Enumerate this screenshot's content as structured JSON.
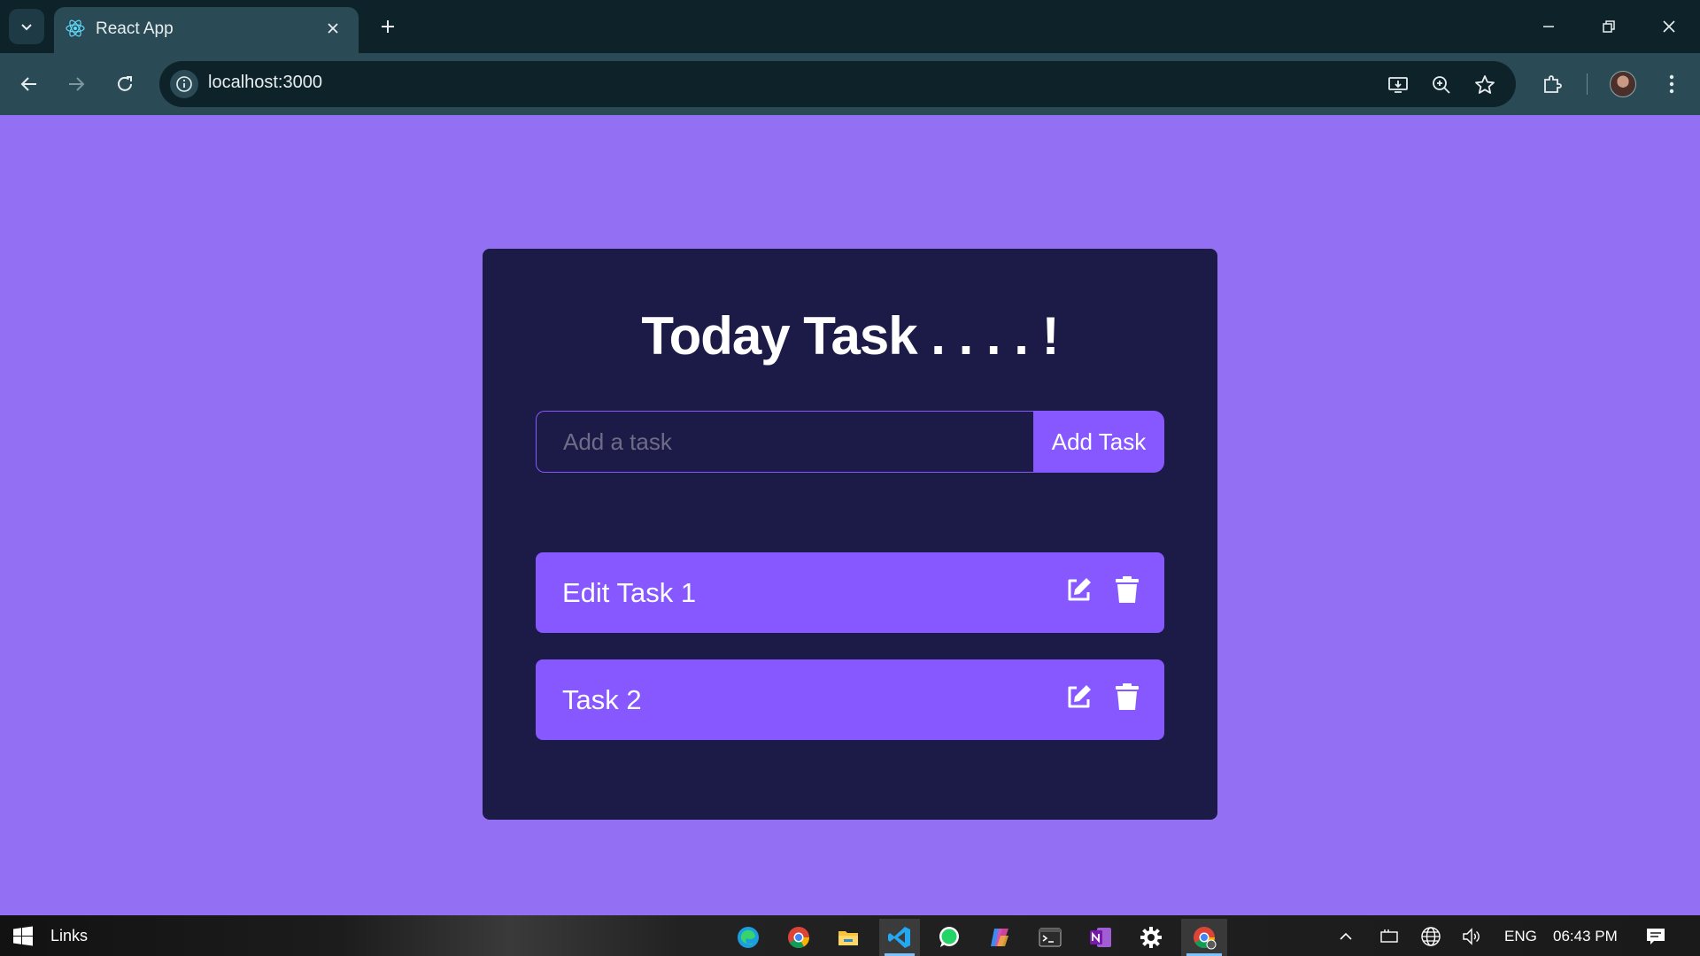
{
  "browser": {
    "tab_title": "React App",
    "url": "localhost:3000"
  },
  "app": {
    "title": "Today Task . . . . !",
    "input": {
      "placeholder": "Add a task",
      "value": ""
    },
    "add_button_label": "Add Task",
    "tasks": [
      {
        "text": "Edit Task 1"
      },
      {
        "text": "Task 2"
      }
    ],
    "colors": {
      "background": "#9370f3",
      "card": "#1c1b48",
      "accent": "#8758ff"
    }
  },
  "taskbar": {
    "links_label": "Links",
    "language": "ENG",
    "time": "06:43 PM",
    "pinned_apps": [
      "edge-icon",
      "chrome-icon",
      "file-explorer-icon",
      "vscode-icon",
      "whatsapp-icon",
      "copilot-icon",
      "terminal-icon",
      "onenote-icon",
      "settings-icon",
      "chrome-active-icon"
    ]
  }
}
